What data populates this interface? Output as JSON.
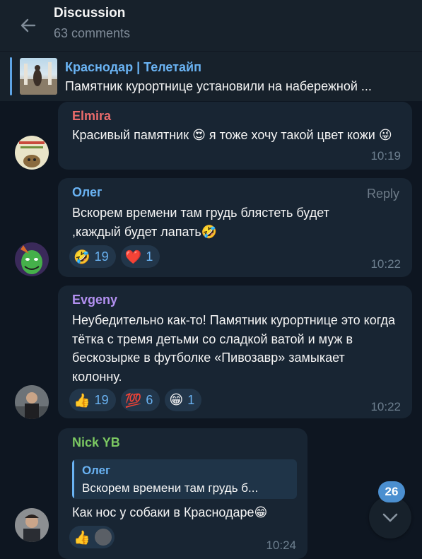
{
  "header": {
    "title": "Discussion",
    "subtitle": "63 comments"
  },
  "pinned": {
    "channel": "Краснодар | Телетайп",
    "text": "Памятник курортнице установили на набережной ..."
  },
  "comments": [
    {
      "author": "Elmira",
      "author_color": "#ea6b6b",
      "text": "Красивый памятник 😍 я тоже хочу такой цвет кожи 😜",
      "time": "10:19"
    },
    {
      "author": "Олег",
      "author_color": "#6ab3f3",
      "reply_label": "Reply",
      "text": "Вскорем времени там грудь блястеть будет ,каждый будет лапать🤣",
      "time": "10:22",
      "reactions": [
        {
          "emoji": "🤣",
          "count": "19"
        },
        {
          "emoji": "❤️",
          "count": "1"
        }
      ]
    },
    {
      "author": "Evgeny",
      "author_color": "#b290f0",
      "text": "Неубедительно как-то! Памятник курортнице это когда тётка с тремя детьми со сладкой ватой и муж в бескозырке в футболке «Пивозавр» замыкает колонну.",
      "time": "10:22",
      "reactions": [
        {
          "emoji": "👍",
          "count": "19"
        },
        {
          "emoji": "💯",
          "count": "6"
        },
        {
          "emoji": "😁",
          "count": "1"
        }
      ]
    },
    {
      "author": "Nick YB",
      "author_color": "#7bc862",
      "quote": {
        "author": "Олег",
        "text": "Вскорем времени там грудь б..."
      },
      "text": "Как нос у собаки в Краснодаре😁",
      "time": "10:24",
      "reactions": [
        {
          "emoji": "👍",
          "count": ""
        }
      ]
    }
  ],
  "scroll_down": {
    "unread_count": "26",
    "icon": "chevron-down-icon"
  },
  "colors": {
    "background": "#0e1621",
    "header": "#17212b",
    "bubble": "#182533",
    "accent": "#6ab3f3"
  }
}
